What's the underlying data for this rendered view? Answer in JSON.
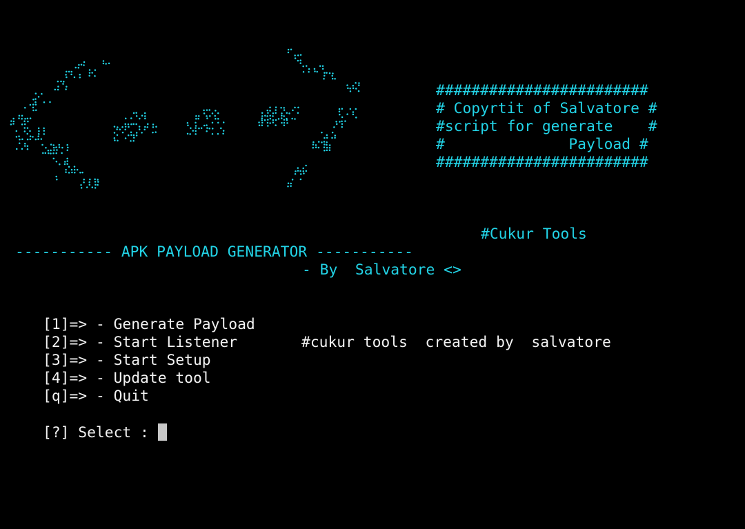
{
  "colors": {
    "background": "#000000",
    "accent": "#22d3e6",
    "text": "#f2f2f2",
    "cursor": "#c8c8c8"
  },
  "banner": {
    "logo_description": "braille-dot ascii art logo",
    "box_lines": [
      "########################",
      "# Copyrtit of Salvatore #",
      "#script for generate    #",
      "#              Payload #",
      "########################"
    ]
  },
  "header": {
    "tag": "#Cukur Tools",
    "title": "----------- APK PAYLOAD GENERATOR -----------",
    "byline": "- By  Salvatore <>"
  },
  "menu": {
    "items": [
      {
        "key": "[1]=>",
        "label": "- Generate Payload"
      },
      {
        "key": "[2]=>",
        "label": "- Start Listener"
      },
      {
        "key": "[3]=>",
        "label": "- Start Setup"
      },
      {
        "key": "[4]=>",
        "label": "- Update tool"
      },
      {
        "key": "[q]=>",
        "label": "- Quit"
      }
    ],
    "side_note": "#cukur tools  created by  salvatore"
  },
  "prompt": {
    "text": "[?] Select : "
  }
}
